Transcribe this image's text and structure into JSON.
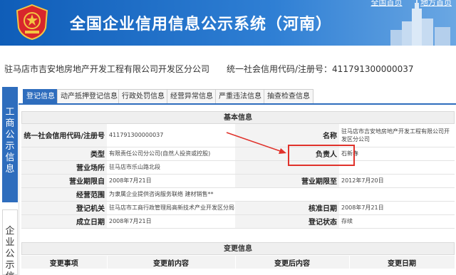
{
  "header": {
    "title": "全国企业信用信息公示系统（河南）",
    "links": [
      "全国首页",
      "地方首页"
    ]
  },
  "company": {
    "name": "驻马店市吉安地房地产开发工程有限公司开发区分公司",
    "usc_label": "统一社会信用代码/注册号：",
    "usc_value": "411791300000037"
  },
  "left_nav": {
    "section1": [
      "工",
      "商",
      "公",
      "示",
      "信",
      "息"
    ],
    "section2": [
      "企",
      "业",
      "公",
      "示",
      "信"
    ]
  },
  "tabs": [
    "登记信息",
    "动产抵押登记信息",
    "行政处罚信息",
    "经营异常信息",
    "严重违法信息",
    "抽查检查信息"
  ],
  "basic": {
    "title": "基本信息",
    "usc_label": "统一社会信用代码/注册号",
    "usc_value": "411791300000037",
    "name_label": "名称",
    "name_value": "驻马店市吉安地房地产开发工程有限公司开发区分公司",
    "type_label": "类型",
    "type_value": "有限责任公司分公司(自然人投资或控股)",
    "person_label": "负责人",
    "person_value": "石新春",
    "place_label": "营业场所",
    "place_value": "驻马店市乐山路北段",
    "from_label": "营业期限自",
    "from_value": "2008年7月21日",
    "to_label": "营业期限至",
    "to_value": "2012年7月20日",
    "scope_label": "经营范围",
    "scope_value": "为隶属企业提供咨询服务联络 建材销售**",
    "authority_label": "登记机关",
    "authority_value": "驻马店市工商行政管理局高新技术产业开发区分局",
    "approve_label": "核准日期",
    "approve_value": "2008年7月21日",
    "est_label": "成立日期",
    "est_value": "2008年7月21日",
    "status_label": "登记状态",
    "status_value": "存续"
  },
  "changes": {
    "title": "变更信息",
    "columns": [
      "变更事项",
      "变更前内容",
      "变更后内容",
      "变更日期"
    ]
  },
  "colors": {
    "banner": "#0f5db8",
    "nav": "#2e6dbd",
    "highlight": "#e0322b"
  }
}
